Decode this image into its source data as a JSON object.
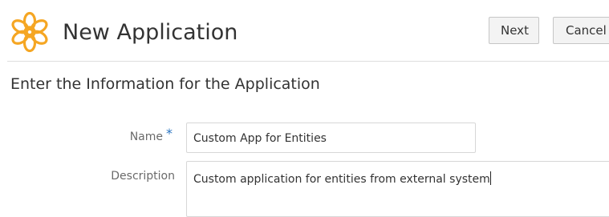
{
  "header": {
    "title": "New Application",
    "logo_icon": "flower-icon",
    "logo_color": "#f5a623",
    "next_label": "Next",
    "cancel_label": "Cancel"
  },
  "form": {
    "section_title": "Enter the Information for the Application",
    "name_label": "Name",
    "required_marker": "*",
    "name_value": "Custom App for Entities",
    "description_label": "Description",
    "description_value": "Custom application for entities from external system"
  },
  "colors": {
    "required_marker": "#2a74c0"
  }
}
